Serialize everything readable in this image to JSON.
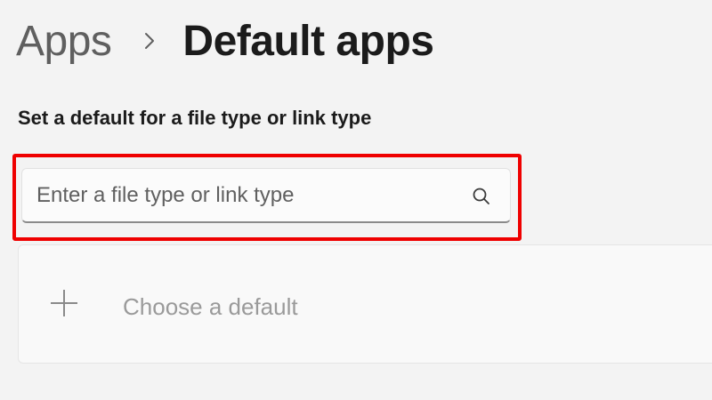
{
  "breadcrumb": {
    "parent": "Apps",
    "separator_icon": "chevron-right-icon",
    "current": "Default apps"
  },
  "section": {
    "heading": "Set a default for a file type or link type"
  },
  "search": {
    "value": "",
    "placeholder": "Enter a file type or link type",
    "icon": "search-icon"
  },
  "choose_default": {
    "icon": "plus-icon",
    "label": "Choose a default"
  },
  "colors": {
    "background": "#f3f3f3",
    "highlight": "#ef0000",
    "text_primary": "#1b1b1b",
    "text_secondary": "#5f5f5f",
    "text_disabled": "#9a9a9a"
  }
}
